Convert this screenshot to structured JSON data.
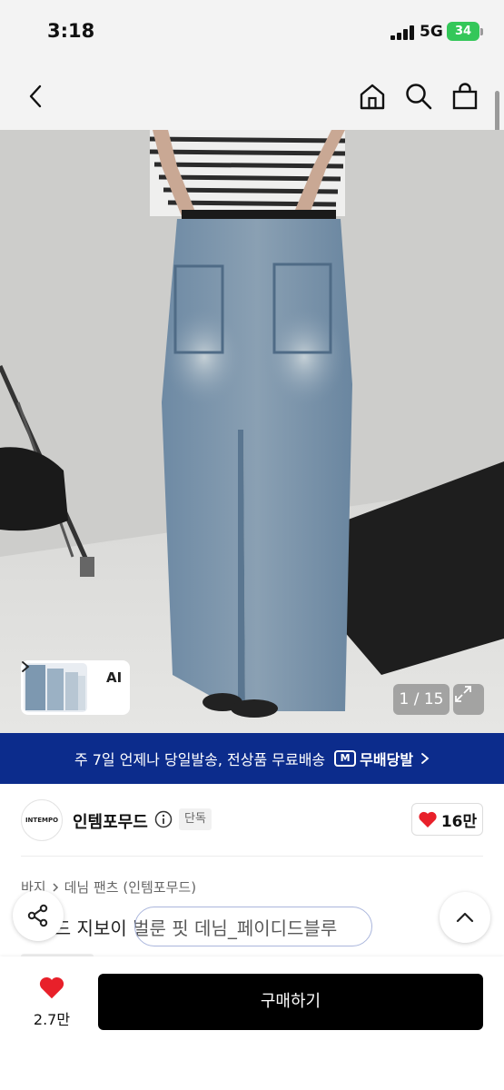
{
  "status_bar": {
    "time": "3:18",
    "network": "5G",
    "battery": "34"
  },
  "nav": {
    "back_icon": "chevron-left-icon",
    "home_icon": "home-icon",
    "search_icon": "search-icon",
    "bag_icon": "shopping-bag-icon"
  },
  "gallery": {
    "counter": "1 / 15",
    "ai_label": "AI",
    "expand_icon": "expand-icon"
  },
  "promo": {
    "text": "주 7일 언제나 당일발송, 전상품 무료배송",
    "badge_icon": "M",
    "badge_label": "무배당발",
    "colors": {
      "background": "#0c2c8c"
    }
  },
  "shop": {
    "logo_text": "INTEMPO",
    "name": "인템포무드",
    "tag": "단독",
    "likes": "16만"
  },
  "breadcrumb": {
    "category": "바지",
    "subcategory": "데님 팬츠 (인템포무드)"
  },
  "product": {
    "title": "와이드 지보이 벌룬 핏 데님_페이디드블루"
  },
  "bottom": {
    "wish_count": "2.7만",
    "buy_label": "구매하기"
  },
  "colors": {
    "accent_red": "#e8202a",
    "button_black": "#000000"
  }
}
